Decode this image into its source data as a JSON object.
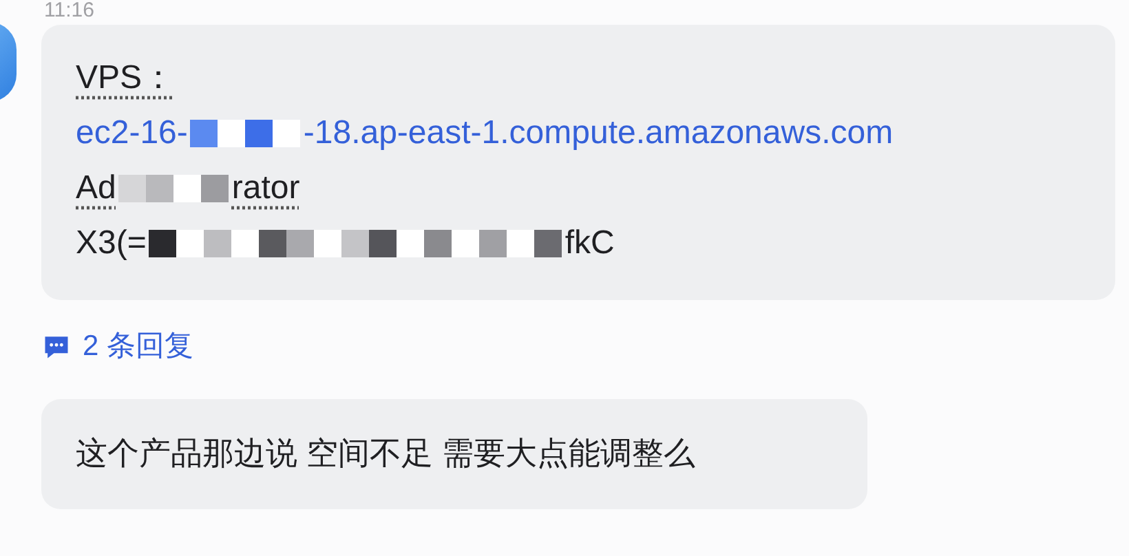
{
  "timestamp": "11:16",
  "message": {
    "lines": [
      {
        "kind": "plain",
        "underlined": true,
        "segments": [
          {
            "kind": "text",
            "text": "VPS："
          }
        ]
      },
      {
        "kind": "link",
        "underlined": false,
        "segments": [
          {
            "kind": "text",
            "text": "ec2-16-"
          },
          {
            "kind": "mosaic"
          },
          {
            "kind": "text",
            "text": "-18.ap-east-1.compute.amazonaws.com"
          }
        ]
      },
      {
        "kind": "plain",
        "underlined": true,
        "segments": [
          {
            "kind": "text",
            "text": "Ad"
          },
          {
            "kind": "mosaic"
          },
          {
            "kind": "text",
            "text": "rator"
          }
        ]
      },
      {
        "kind": "plain",
        "underlined": false,
        "segments": [
          {
            "kind": "text",
            "text": "X3(="
          },
          {
            "kind": "mosaic"
          },
          {
            "kind": "text",
            "text": "fkC"
          }
        ]
      }
    ]
  },
  "replies": {
    "label": "2 条回复"
  },
  "message_2": {
    "text": "这个产品那边说 空间不足 需要大点能调整么"
  }
}
